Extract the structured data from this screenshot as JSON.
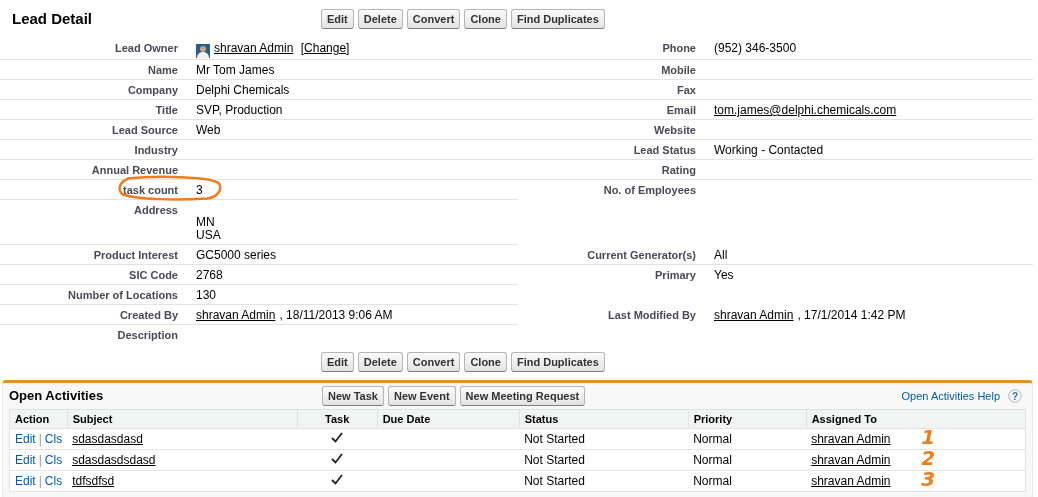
{
  "detail": {
    "title": "Lead Detail",
    "buttons": [
      "Edit",
      "Delete",
      "Convert",
      "Clone",
      "Find Duplicates"
    ],
    "rows": [
      {
        "left": {
          "label": "Lead Owner",
          "value": [
            {
              "kind": "avatar"
            },
            {
              "kind": "link",
              "text": "shravan Admin"
            },
            {
              "kind": "link",
              "text": "[Change]"
            }
          ]
        },
        "right": {
          "label": "Phone",
          "value": [
            {
              "kind": "text",
              "text": "(952) 346-3500"
            }
          ]
        }
      },
      {
        "left": {
          "label": "Name",
          "value": [
            {
              "kind": "text",
              "text": "Mr Tom James"
            }
          ]
        },
        "right": {
          "label": "Mobile"
        }
      },
      {
        "left": {
          "label": "Company",
          "value": [
            {
              "kind": "text",
              "text": "Delphi Chemicals"
            }
          ]
        },
        "right": {
          "label": "Fax"
        }
      },
      {
        "left": {
          "label": "Title",
          "value": [
            {
              "kind": "text",
              "text": "SVP, Production"
            }
          ]
        },
        "right": {
          "label": "Email",
          "value": [
            {
              "kind": "link",
              "text": "tom.james@delphi.chemicals.com"
            }
          ]
        }
      },
      {
        "left": {
          "label": "Lead Source",
          "value": [
            {
              "kind": "text",
              "text": "Web"
            }
          ]
        },
        "right": {
          "label": "Website"
        }
      },
      {
        "left": {
          "label": "Industry"
        },
        "right": {
          "label": "Lead Status",
          "value": [
            {
              "kind": "text",
              "text": "Working - Contacted"
            }
          ]
        }
      },
      {
        "left": {
          "label": "Annual Revenue"
        },
        "right": {
          "label": "Rating"
        }
      },
      {
        "left": {
          "label": "task count",
          "circled": true,
          "value": [
            {
              "kind": "text",
              "text": "3"
            }
          ]
        },
        "right": {
          "label": "No. of Employees"
        }
      },
      {
        "left": {
          "label": "Address",
          "kind": "address",
          "value": [
            {
              "kind": "line",
              "text": "MN"
            },
            {
              "kind": "line",
              "text": "USA"
            }
          ]
        }
      },
      {
        "left": {
          "label": "Product Interest",
          "value": [
            {
              "kind": "text",
              "text": "GC5000 series"
            }
          ]
        },
        "right": {
          "label": "Current Generator(s)",
          "value": [
            {
              "kind": "text",
              "text": "All"
            }
          ]
        }
      },
      {
        "left": {
          "label": "SIC Code",
          "value": [
            {
              "kind": "text",
              "text": "2768"
            }
          ]
        },
        "right": {
          "label": "Primary",
          "value": [
            {
              "kind": "text",
              "text": "Yes"
            }
          ]
        }
      },
      {
        "left": {
          "label": "Number of Locations",
          "value": [
            {
              "kind": "text",
              "text": "130"
            }
          ]
        }
      },
      {
        "left": {
          "label": "Created By",
          "value": [
            {
              "kind": "link",
              "text": "shravan Admin"
            },
            {
              "kind": "text",
              "text": ", 18/11/2013 9:06 AM"
            }
          ]
        },
        "right": {
          "label": "Last Modified By",
          "value": [
            {
              "kind": "link",
              "text": "shravan Admin"
            },
            {
              "kind": "text",
              "text": ", 17/1/2014 1:42 PM"
            }
          ]
        }
      },
      {
        "left": {
          "label": "Description"
        }
      }
    ],
    "bottom_buttons": [
      "Edit",
      "Delete",
      "Convert",
      "Clone",
      "Find Duplicates"
    ]
  },
  "open_activities": {
    "title": "Open Activities",
    "buttons": [
      "New Task",
      "New Event",
      "New Meeting Request"
    ],
    "help": "Open Activities Help",
    "help_icon": "?",
    "columns": [
      "Action",
      "Subject",
      "Task",
      "Due Date",
      "Status",
      "Priority",
      "Assigned To"
    ],
    "action_separator": "|",
    "rows": [
      {
        "actions": [
          "Edit",
          "Cls"
        ],
        "subject": "sdasdasdasd",
        "task": true,
        "status": "Not Started",
        "priority": "Normal",
        "assigned_to": "shravan Admin",
        "note": "1"
      },
      {
        "actions": [
          "Edit",
          "Cls"
        ],
        "subject": "sdasdasdsdasd",
        "task": true,
        "status": "Not Started",
        "priority": "Normal",
        "assigned_to": "shravan Admin",
        "note": "2"
      },
      {
        "actions": [
          "Edit",
          "Cls"
        ],
        "subject": "tdfsdfsd",
        "task": true,
        "status": "Not Started",
        "priority": "Normal",
        "assigned_to": "shravan Admin",
        "note": "3"
      }
    ]
  }
}
